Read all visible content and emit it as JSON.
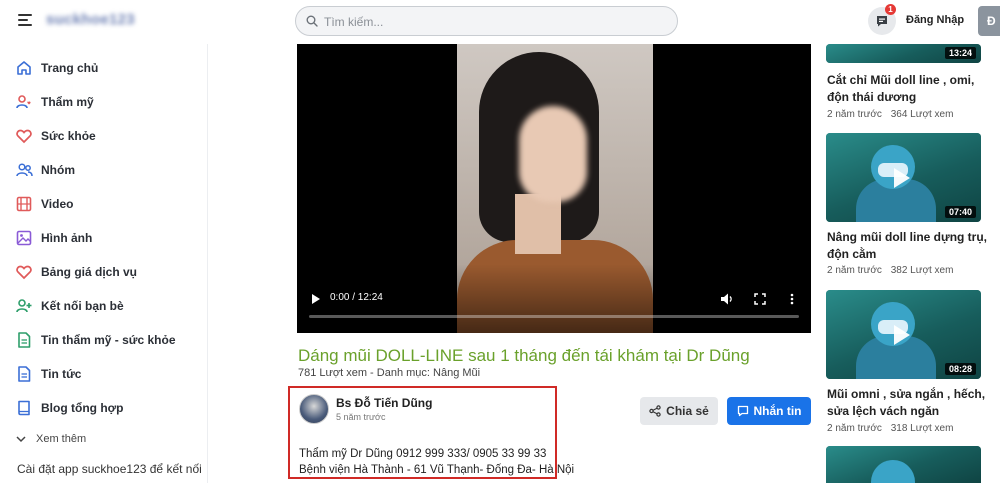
{
  "header": {
    "logo_text": "suckhoe123",
    "search_placeholder": "Tìm kiếm...",
    "message_badge": "1",
    "login_label": "Đăng Nhập",
    "avatar_letter": "Đ"
  },
  "sidebar": {
    "items": [
      {
        "label": "Trang chủ",
        "icon": "home-icon"
      },
      {
        "label": "Thẩm mỹ",
        "icon": "user-heart-icon"
      },
      {
        "label": "Sức khỏe",
        "icon": "heart-icon"
      },
      {
        "label": "Nhóm",
        "icon": "group-icon"
      },
      {
        "label": "Video",
        "icon": "film-icon"
      },
      {
        "label": "Hình ảnh",
        "icon": "image-icon"
      },
      {
        "label": "Bảng giá dịch vụ",
        "icon": "heart-icon"
      },
      {
        "label": "Kết nối bạn bè",
        "icon": "user-plus-icon"
      },
      {
        "label": "Tin thẩm mỹ - sức khỏe",
        "icon": "document-icon"
      },
      {
        "label": "Tin tức",
        "icon": "document-icon"
      },
      {
        "label": "Blog tổng hợp",
        "icon": "book-icon"
      }
    ],
    "see_more": "Xem thêm",
    "app_note": "Cài đặt app suckhoe123 để kết nối"
  },
  "video": {
    "time": "0:00 / 12:24",
    "progress": 0.0,
    "title": "Dáng mũi DOLL-LINE sau 1 tháng đến tái khám tại Dr Dũng",
    "meta": "781 Lượt xem - Danh mục: Nâng Mũi"
  },
  "author": {
    "name": "Bs Đỗ Tiến Dũng",
    "time": "5 năm trước",
    "desc_line1": "Thẩm mỹ Dr Dũng 0912 999 333/ 0905 33 99 33",
    "desc_line2": "Bệnh viện Hà Thành - 61 Vũ Thạnh- Đống Đa- Hà Nội"
  },
  "actions": {
    "share": "Chia sẻ",
    "message": "Nhắn tin"
  },
  "related": [
    {
      "title": "Cắt chỉ Mũi doll line , omi, độn thái dương",
      "ago": "2 năm trước",
      "views": "364 Lượt xem",
      "duration": "13:24"
    },
    {
      "title": "Nâng mũi doll line dựng trụ, độn cằm",
      "ago": "2 năm trước",
      "views": "382 Lượt xem",
      "duration": "07:40"
    },
    {
      "title": "Mũi omni , sửa ngắn , hếch, sửa lệch vách ngăn",
      "ago": "2 năm trước",
      "views": "318 Lượt xem",
      "duration": "08:28"
    }
  ],
  "colors": {
    "title_green": "#6aa12b",
    "primary_blue": "#1a73e8",
    "highlight_red": "#d02a26",
    "icon_blue": "#3b6fd6",
    "icon_red": "#e05a5a",
    "icon_green": "#2e9e6b"
  }
}
